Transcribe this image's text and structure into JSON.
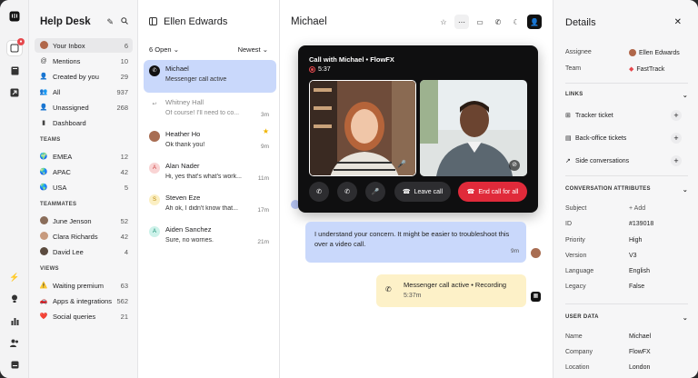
{
  "colors": {
    "accent": "#c9d8fb",
    "end_call": "#e02a3a",
    "system_bg": "#fdf1c8"
  },
  "sidebar": {
    "title": "Help Desk",
    "items": [
      {
        "label": "Your Inbox",
        "count": "6",
        "icon": "avatar"
      },
      {
        "label": "Mentions",
        "count": "10",
        "icon": "at-icon"
      },
      {
        "label": "Created by you",
        "count": "29",
        "icon": "user-plus-icon"
      },
      {
        "label": "All",
        "count": "937",
        "icon": "users-icon"
      },
      {
        "label": "Unassigned",
        "count": "268",
        "icon": "user-minus-icon"
      },
      {
        "label": "Dashboard",
        "count": "",
        "icon": "chart-icon"
      }
    ],
    "teams_header": "TEAMS",
    "teams": [
      {
        "label": "EMEA",
        "count": "12"
      },
      {
        "label": "APAC",
        "count": "42"
      },
      {
        "label": "USA",
        "count": "5"
      }
    ],
    "teammates_header": "TEAMMATES",
    "teammates": [
      {
        "label": "June Jenson",
        "count": "52"
      },
      {
        "label": "Clara Richards",
        "count": "42"
      },
      {
        "label": "David Lee",
        "count": "4"
      }
    ],
    "views_header": "VIEWS",
    "views": [
      {
        "label": "Waiting premium",
        "count": "63"
      },
      {
        "label": "Apps & integrations",
        "count": "562"
      },
      {
        "label": "Social queries",
        "count": "21"
      }
    ]
  },
  "list": {
    "title": "Ellen Edwards",
    "filter": "6 Open",
    "sort": "Newest",
    "conversations": [
      {
        "name": "Michael",
        "message": "Messenger call active",
        "time": ""
      },
      {
        "name": "Whitney Hall",
        "message": "Of course! I'll need to co...",
        "time": "3m"
      },
      {
        "name": "Heather Ho",
        "message": "Ok thank you!",
        "time": "9m"
      },
      {
        "name": "Alan Nader",
        "message": "Hi, yes that's what's work...",
        "time": "11m",
        "initial": "A"
      },
      {
        "name": "Steven Eze",
        "message": "Ah ok, I didn't know that...",
        "time": "17m",
        "initial": "S"
      },
      {
        "name": "Aiden Sanchez",
        "message": "Sure, no worries.",
        "time": "21m",
        "initial": "A"
      }
    ]
  },
  "main": {
    "title": "Michael",
    "call": {
      "title": "Call with Michael • FlowFX",
      "timer": "5:37",
      "leave_label": "Leave call",
      "end_label": "End call for all"
    },
    "bubble": {
      "text": "I understand your concern. It might be easier to troubleshoot this over a video call.",
      "time": "9m"
    },
    "system": {
      "line1": "Messenger call active • Recording",
      "line2": "5:37m"
    }
  },
  "details": {
    "title": "Details",
    "assignee_label": "Assignee",
    "assignee": "Ellen Edwards",
    "team_label": "Team",
    "team": "FastTrack",
    "links_header": "LINKS",
    "links": [
      {
        "label": "Tracker ticket",
        "icon": "tracker-icon"
      },
      {
        "label": "Back-office tickets",
        "icon": "clipboard-icon"
      },
      {
        "label": "Side conversations",
        "icon": "arrow-icon"
      }
    ],
    "attrs_header": "CONVERSATION ATTRIBUTES",
    "attrs": [
      {
        "k": "Subject",
        "v": "+ Add"
      },
      {
        "k": "ID",
        "v": "#139018"
      },
      {
        "k": "Priority",
        "v": "High"
      },
      {
        "k": "Version",
        "v": "V3"
      },
      {
        "k": "Language",
        "v": "English"
      },
      {
        "k": "Legacy",
        "v": "False"
      }
    ],
    "user_header": "USER DATA",
    "user": [
      {
        "k": "Name",
        "v": "Michael"
      },
      {
        "k": "Company",
        "v": "FlowFX"
      },
      {
        "k": "Location",
        "v": "London"
      }
    ]
  }
}
